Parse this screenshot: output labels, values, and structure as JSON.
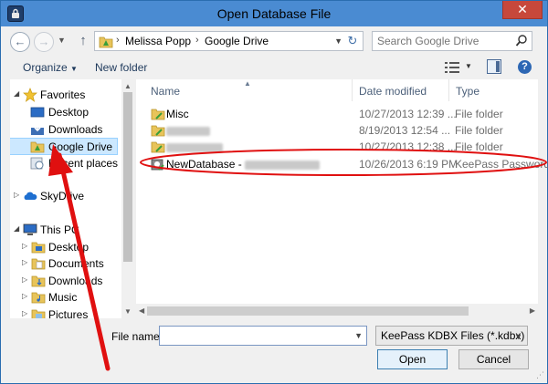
{
  "window": {
    "title": "Open Database File",
    "close_glyph": "✕"
  },
  "address_bar": {
    "breadcrumbs": [
      "Melissa Popp",
      "Google Drive"
    ],
    "separator": "›"
  },
  "search": {
    "placeholder": "Search Google Drive"
  },
  "toolbar": {
    "organize_label": "Organize",
    "new_folder_label": "New folder",
    "help_glyph": "?"
  },
  "nav_pane": {
    "items": [
      {
        "label": "Favorites",
        "icon": "star-icon"
      },
      {
        "label": "Desktop",
        "icon": "desktop-icon"
      },
      {
        "label": "Downloads",
        "icon": "downloads-icon"
      },
      {
        "label": "Google Drive",
        "icon": "google-drive-folder-icon",
        "selected": true
      },
      {
        "label": "Recent places",
        "icon": "recent-places-icon"
      },
      {
        "label": "SkyDrive",
        "icon": "cloud-icon"
      },
      {
        "label": "This PC",
        "icon": "computer-icon"
      },
      {
        "label": "Desktop",
        "icon": "desktop-folder-icon"
      },
      {
        "label": "Documents",
        "icon": "documents-folder-icon"
      },
      {
        "label": "Downloads",
        "icon": "downloads-folder-icon"
      },
      {
        "label": "Music",
        "icon": "music-folder-icon"
      },
      {
        "label": "Pictures",
        "icon": "pictures-folder-icon"
      }
    ]
  },
  "file_list": {
    "columns": [
      "Name",
      "Date modified",
      "Type"
    ],
    "rows": [
      {
        "name": "Misc",
        "date": "10/27/2013 12:39 ...",
        "type": "File folder"
      },
      {
        "name": "",
        "date": "8/19/2013 12:54 ...",
        "type": "File folder"
      },
      {
        "name": "",
        "date": "10/27/2013 12:38 ...",
        "type": "File folder"
      },
      {
        "name": "NewDatabase - ",
        "date": "10/26/2013 6:19 PM",
        "type": "KeePass Password..."
      }
    ]
  },
  "bottom": {
    "file_name_label": "File name:",
    "file_name_value": "",
    "filter_label": "KeePass KDBX Files (*.kdbx)",
    "open_label": "Open",
    "cancel_label": "Cancel"
  },
  "colors": {
    "titlebar": "#4a8bd2",
    "selection": "#cce8ff",
    "annotation_red": "#e01010"
  }
}
